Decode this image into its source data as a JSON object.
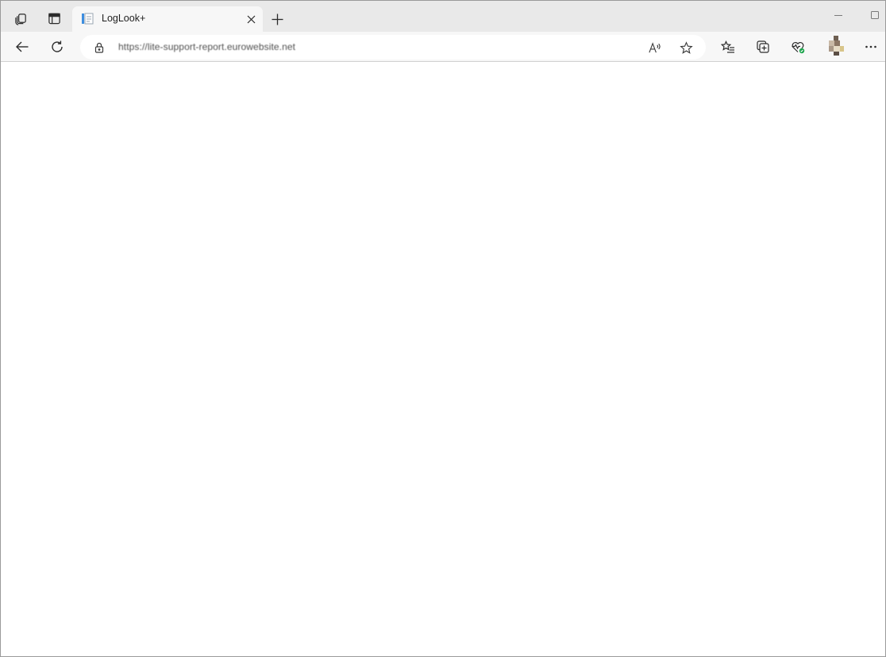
{
  "browser": {
    "tab": {
      "title": "LogLook+"
    },
    "address": {
      "url": "https://lite-support-report.eurowebsite.net"
    }
  },
  "colors": {
    "tabstrip_bg": "#e9e9e9",
    "toolbar_bg": "#f7f7f7",
    "content_bg": "#ffffff",
    "favicon_blue": "#3d8ee0",
    "health_green": "#1aa34a"
  },
  "icons": {
    "workspaces": "workspaces-icon",
    "tab_actions": "tab-actions-icon",
    "favicon": "favicon-icon",
    "close": "close-icon",
    "new_tab": "plus-icon",
    "minimize": "minimize-icon",
    "maximize": "maximize-icon",
    "back": "back-arrow-icon",
    "refresh": "refresh-icon",
    "lock": "lock-icon",
    "read_aloud": "read-aloud-icon",
    "favorite": "star-icon",
    "favorites_list": "favorites-icon",
    "collections": "collections-icon",
    "browser_essentials": "heart-pulse-icon",
    "profile": "profile-avatar",
    "more": "more-icon"
  }
}
